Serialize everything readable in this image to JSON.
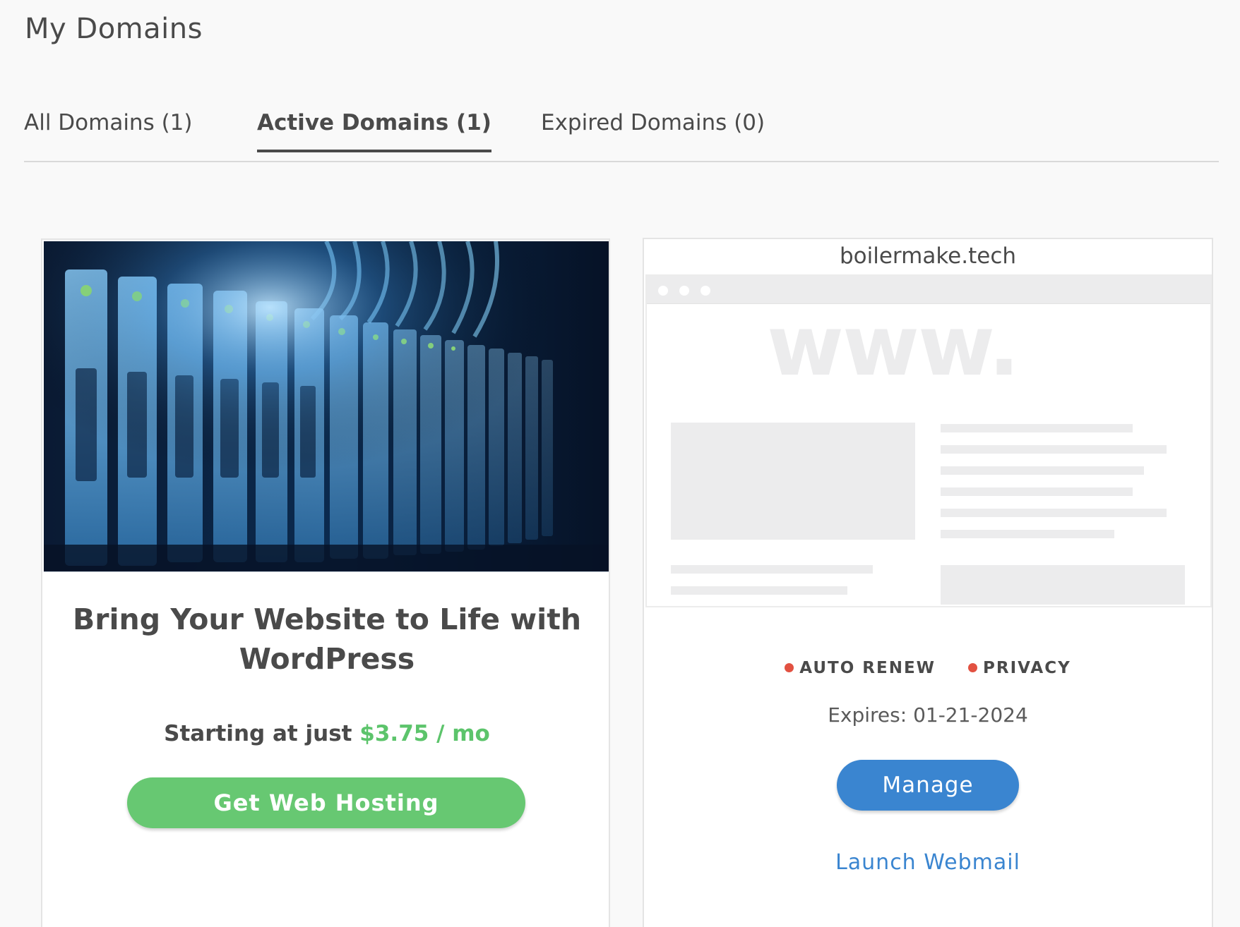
{
  "page": {
    "title": "My Domains"
  },
  "tabs": [
    {
      "label": "All Domains (1)",
      "active": false
    },
    {
      "label": "Active Domains (1)",
      "active": true
    },
    {
      "label": "Expired Domains (0)",
      "active": false
    }
  ],
  "promo": {
    "image": "server-rack-photo",
    "headline_line1": "Bring Your Website to Life with",
    "headline_line2": "WordPress",
    "price_prefix": "Starting at just",
    "price_value": "$3.75 / mo",
    "button_label": "Get Web Hosting",
    "accent_color": "#67c872"
  },
  "domain": {
    "name": "boilermake.tech",
    "preview_mark": "www.",
    "statuses": [
      {
        "label": "AUTO RENEW",
        "color": "#e25141"
      },
      {
        "label": "PRIVACY",
        "color": "#e25141"
      }
    ],
    "expires": "Expires: 01-21-2024",
    "manage_label": "Manage",
    "webmail_label": "Launch Webmail",
    "accent_color": "#3a85d0"
  }
}
